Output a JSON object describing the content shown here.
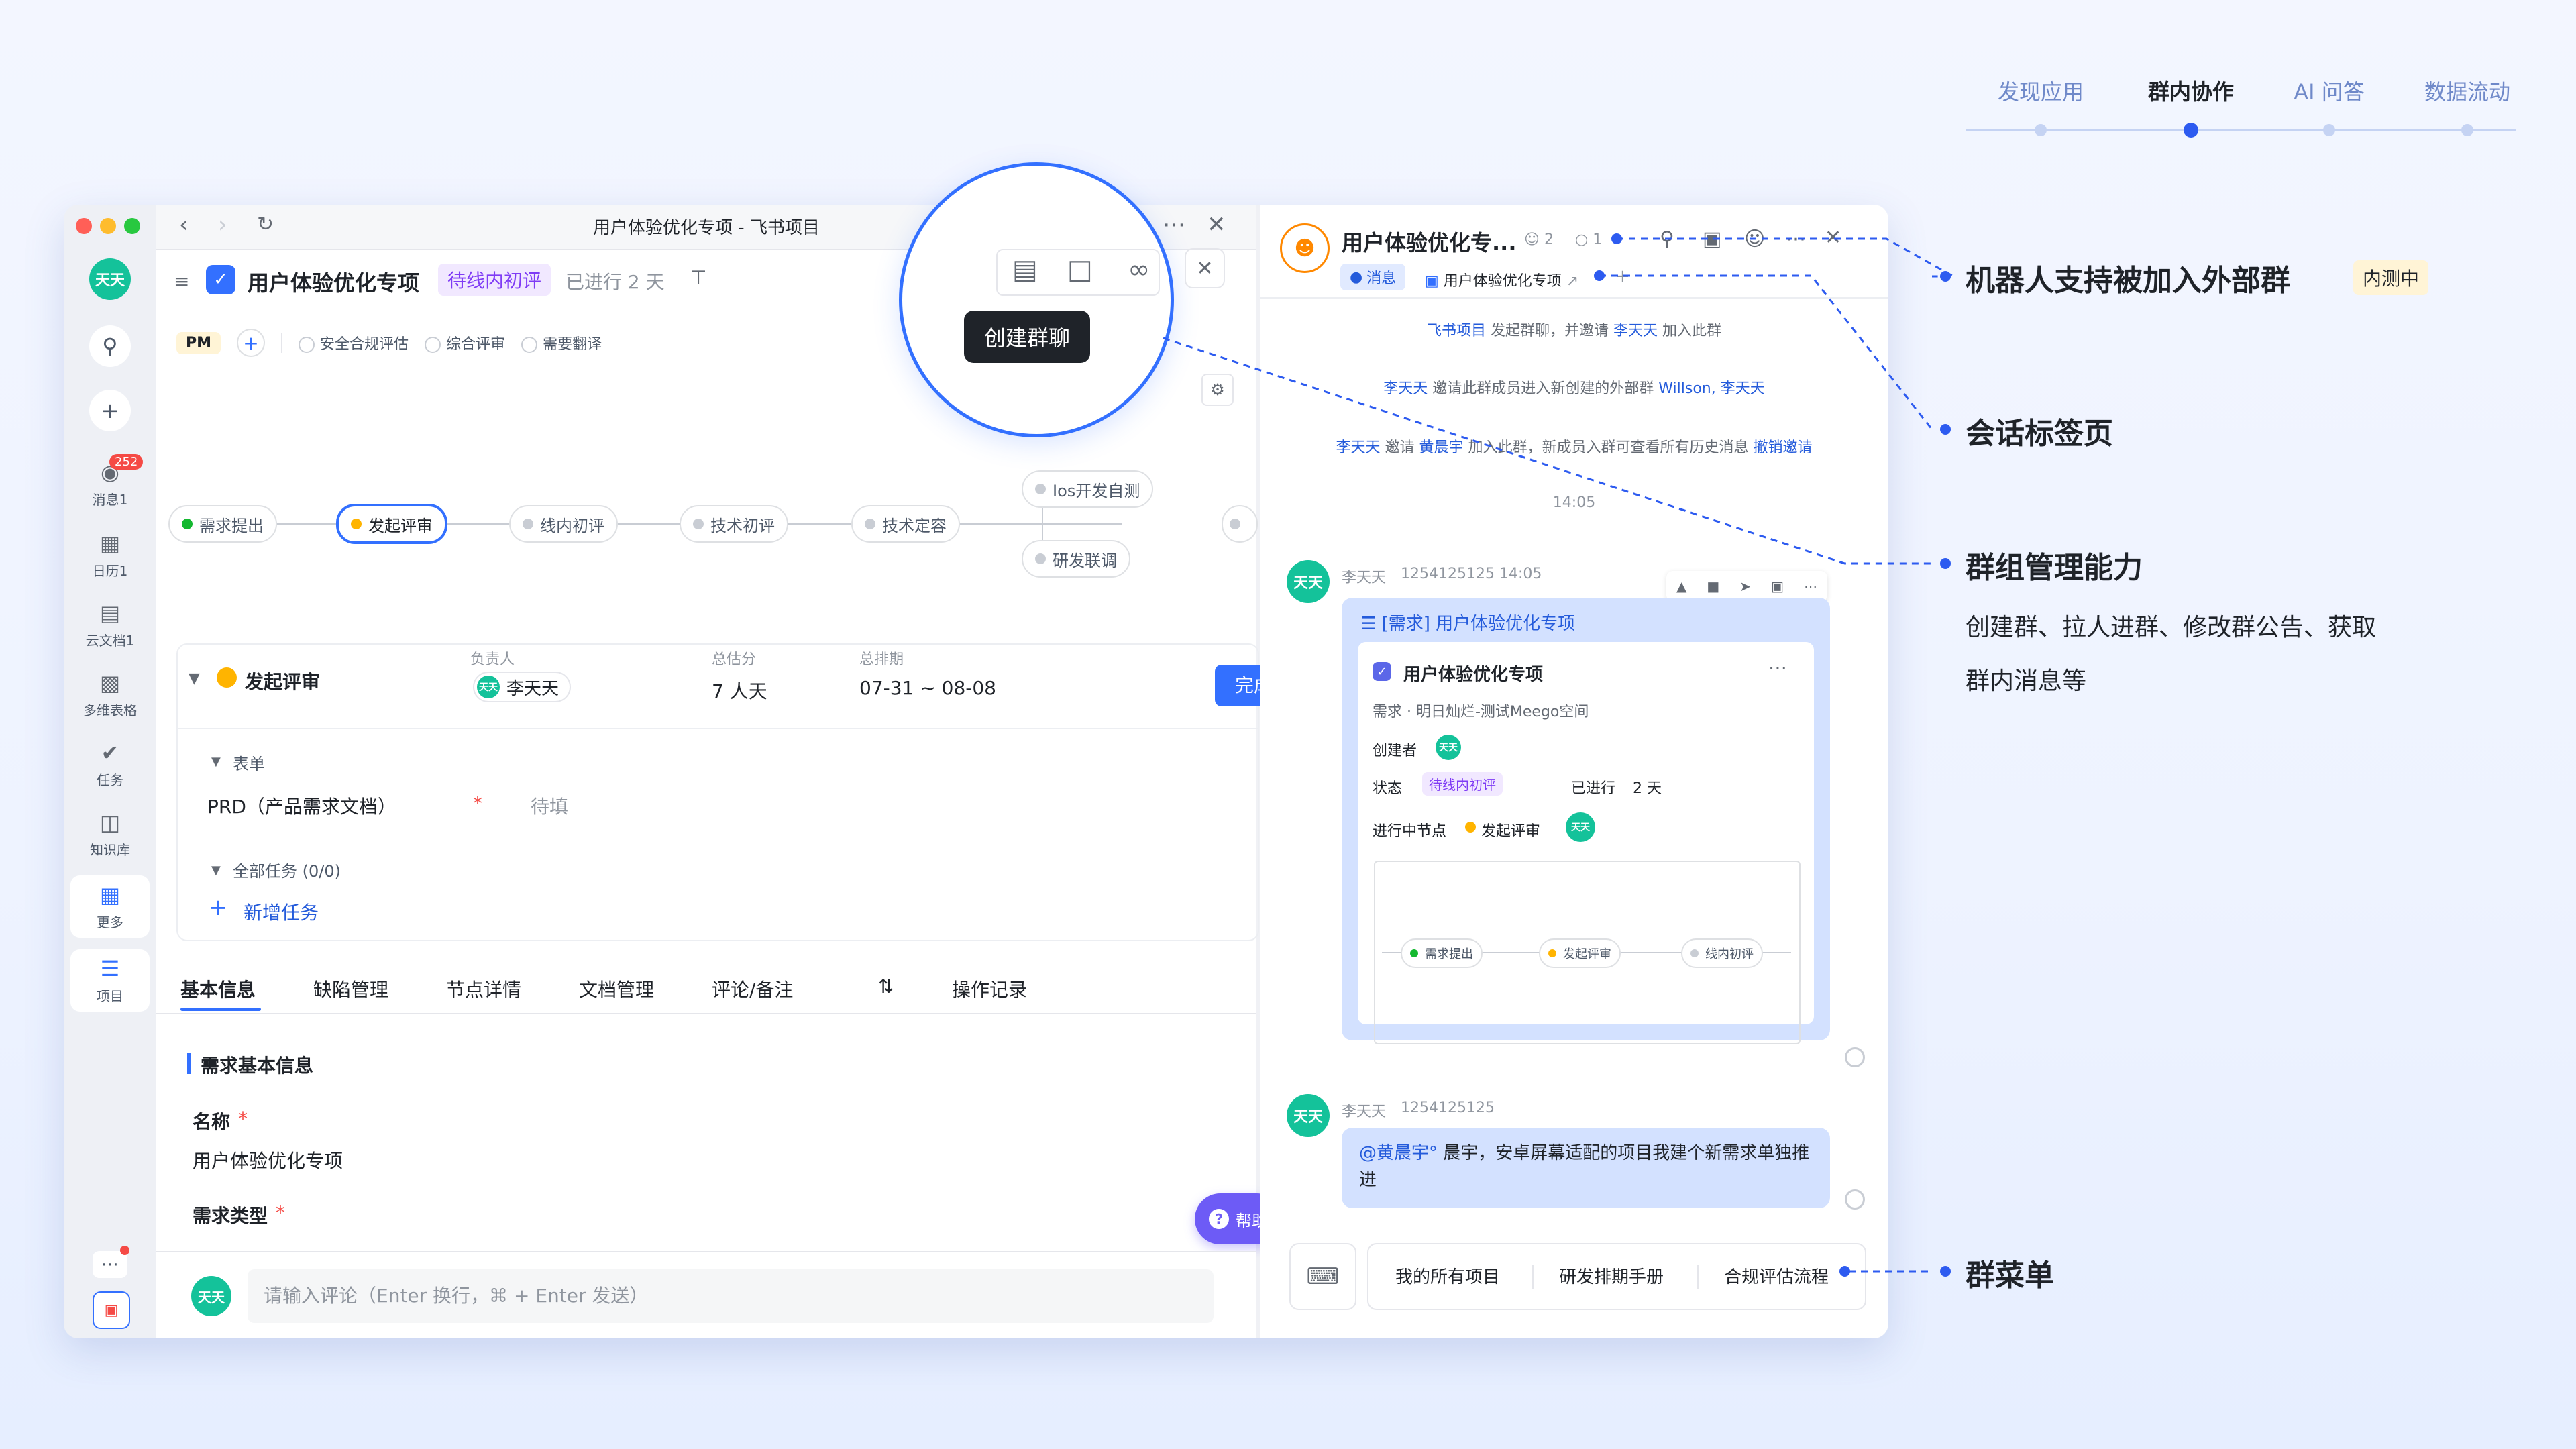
{
  "top_nav": {
    "tabs": [
      "发现应用",
      "群内协作",
      "AI 问答",
      "数据流动"
    ],
    "active_index": 1
  },
  "sidebar": {
    "avatar_text": "天天",
    "unread_badge": "252",
    "items": [
      {
        "label": "消息1",
        "icon": "chat-icon"
      },
      {
        "label": "日历1",
        "icon": "calendar-icon"
      },
      {
        "label": "云文档1",
        "icon": "docs-icon"
      },
      {
        "label": "多维表格",
        "icon": "table-icon"
      },
      {
        "label": "任务",
        "icon": "check-icon"
      },
      {
        "label": "知识库",
        "icon": "book-icon"
      },
      {
        "label": "更多",
        "icon": "grid-icon"
      },
      {
        "label": "项目",
        "icon": "project-icon"
      }
    ],
    "active_item_index": 7
  },
  "project": {
    "window_title": "用户体验优化专项 - 飞书项目",
    "title": "用户体验优化专项",
    "status_tag": "待线内初评",
    "elapsed": "已进行 2 天",
    "role_tag": "PM",
    "checks": [
      "安全合规评估",
      "综合评审",
      "需要翻译"
    ],
    "workflow_nodes": [
      "需求提出",
      "发起评审",
      "线内初评",
      "技术初评",
      "技术定容",
      "Ios开发自测",
      "研发联调"
    ],
    "stage": {
      "name": "发起评审",
      "owner_label": "负责人",
      "owner": "李天天",
      "estimate_label": "总估分",
      "estimate": "7 人天",
      "schedule_label": "总排期",
      "schedule": "07-31 ~ 08-08",
      "complete_button": "完成节点"
    },
    "form_label": "表单",
    "prd_label": "PRD（产品需求文档）",
    "prd_required": "*",
    "prd_value": "待填",
    "tasks_label": "全部任务 (0/0)",
    "add_task": "新增任务",
    "tabs": [
      "基本信息",
      "缺陷管理",
      "节点详情",
      "文档管理",
      "评论/备注",
      "操作记录"
    ],
    "section_title": "需求基本信息",
    "name_label": "名称",
    "name_value": "用户体验优化专项",
    "type_label": "需求类型",
    "help_button": "帮助",
    "comment_placeholder": "请输入评论（Enter 换行，⌘ + Enter 发送）"
  },
  "magnifier": {
    "tooltip": "创建群聊"
  },
  "chat": {
    "group_name": "用户体验优化专...",
    "member_count": "2",
    "bot_count": "1",
    "tab_message": "消息",
    "tab_doc": "用户体验优化专项",
    "sys_messages": [
      {
        "a": "飞书项目",
        "b": " 发起群聊，并邀请 ",
        "c": "李天天",
        "d": " 加入此群"
      },
      {
        "a": "李天天",
        "b": " 邀请此群成员进入新创建的外部群 ",
        "c": "Willson, 李天天",
        "d": ""
      },
      {
        "a": "李天天",
        "b": " 邀请 ",
        "c": "黄晨宇",
        "d": " 加入此群，新成员入群可查看所有历史消息 ",
        "e": "撤销邀请"
      }
    ],
    "time": "14:05",
    "msg1": {
      "sender": "李天天",
      "meta": "1254125125  14:05",
      "card_title": "[需求] 用户体验优化专项",
      "inner_title": "用户体验优化专项",
      "inner_sub": "需求 · 明日灿烂-测试Meego空间",
      "creator_label": "创建者",
      "status_label": "状态",
      "status_value": "待线内初评",
      "elapsed_label": "已进行",
      "elapsed_value": "2 天",
      "node_label": "进行中节点",
      "node_value": "发起评审",
      "mini_nodes": [
        "需求提出",
        "发起评审",
        "线内初评"
      ]
    },
    "msg2": {
      "sender": "李天天",
      "meta": "1254125125",
      "mention": "@黄晨宇°",
      "text": " 晨宇，安卓屏幕适配的项目我建个新需求单独推进"
    },
    "menu": [
      "我的所有项目",
      "研发排期手册",
      "合规评估流程"
    ]
  },
  "annotations": [
    {
      "title": "机器人支持被加入外部群",
      "badge": "内测中"
    },
    {
      "title": "会话标签页"
    },
    {
      "title": "群组管理能力",
      "desc": "创建群、拉人进群、修改群公告、获取群内消息等"
    },
    {
      "title": "群菜单"
    }
  ],
  "colors": {
    "accent": "#3370ff",
    "annotation_blue": "#2d5bf0",
    "avatar_green": "#14c29a",
    "status_purple_bg": "#f1e8ff",
    "status_purple_text": "#7f3bf5",
    "badge_red": "#f54a45",
    "node_done": "#14b830",
    "node_current": "#ffb400"
  }
}
